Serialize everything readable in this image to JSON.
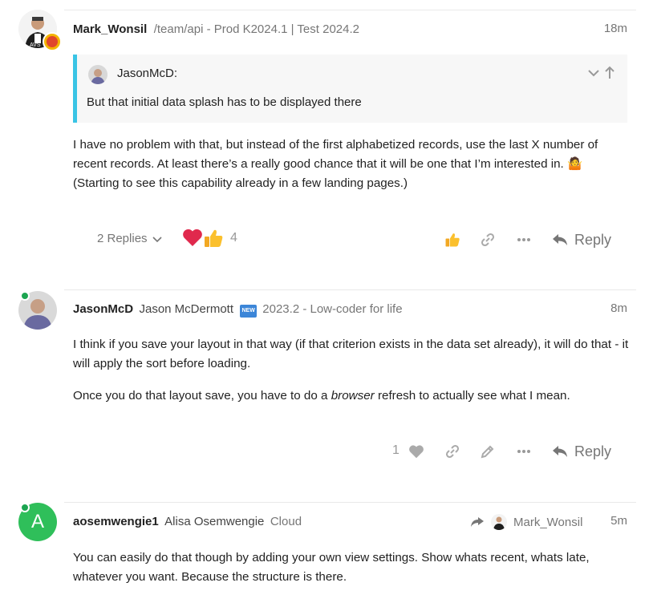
{
  "posts": [
    {
      "username": "Mark_Wonsil",
      "title": "/team/api - Prod K2024.1 | Test 2024.2",
      "time": "18m",
      "avatar_text": "AVS",
      "quote": {
        "author": "JasonMcD:",
        "text": "But that initial data splash has to be displayed there"
      },
      "body": "I have no problem with that, but instead of the first alphabetized records, use the last X number of recent records. At least there’s a really good chance that it will be one that I’m interested in. 🤷",
      "body_2": "(Starting to see this capability already in a few landing pages.)",
      "replies_label": "2 Replies",
      "reaction_count": "4",
      "reply_label": "Reply"
    },
    {
      "username": "JasonMcD",
      "fullname": "Jason McDermott",
      "new_badge": "NEW",
      "title": "2023.2 - Low-coder for life",
      "time": "8m",
      "body_1": "I think if you save your layout in that way (if that criterion exists in the data set already), it will do that - it will apply the sort before loading.",
      "body_2_pre": "Once you do that layout save, you have to do a ",
      "body_2_em": "browser",
      "body_2_post": " refresh to actually see what I mean.",
      "like_count": "1",
      "reply_label": "Reply"
    },
    {
      "username": "aosemwengie1",
      "fullname": "Alisa Osemwengie",
      "title": "Cloud",
      "avatar_letter": "A",
      "reply_to": "Mark_Wonsil",
      "time": "5m",
      "body": "You can easily do that though by adding your own view settings. Show whats recent, whats late, whatever you want. Because the structure is there."
    }
  ],
  "colors": {
    "quote_border": "#3ac4e5",
    "heart": "#e0294d",
    "online": "#1ca551",
    "avatar_green": "#2fbf5a",
    "muted": "#767676"
  },
  "icons": [
    "heart-icon",
    "thumbs-up-icon",
    "link-icon",
    "ellipsis-icon",
    "reply-icon",
    "chevron-down-icon",
    "arrow-up-icon",
    "pencil-icon",
    "reply-to-icon"
  ]
}
